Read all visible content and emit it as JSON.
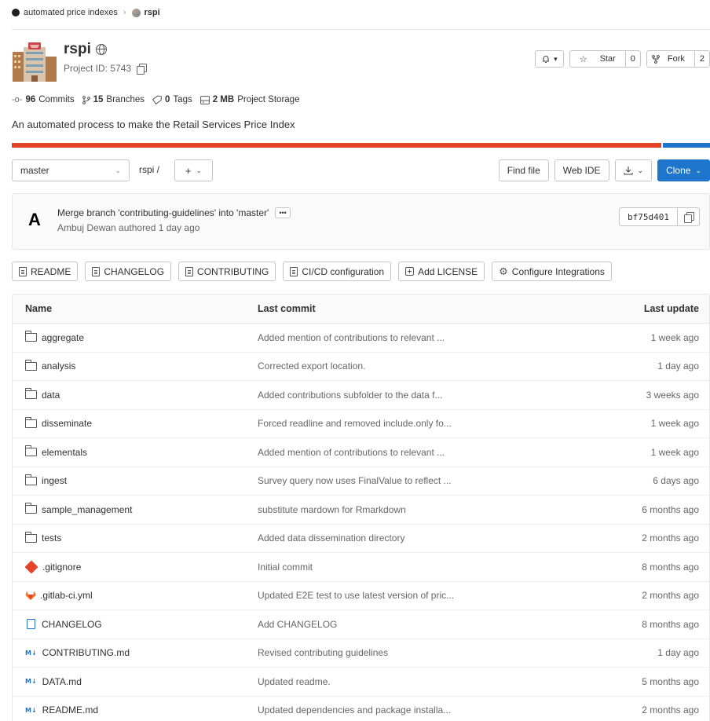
{
  "breadcrumb": {
    "group": "automated price indexes",
    "project": "rspi"
  },
  "project": {
    "name": "rspi",
    "id_text": "Project ID: 5743"
  },
  "actions": {
    "notify_chevron": "⌄",
    "star_label": "Star",
    "star_count": "0",
    "fork_label": "Fork",
    "fork_count": "2"
  },
  "stats": {
    "commits_num": "96",
    "commits_label": "Commits",
    "branches_num": "15",
    "branches_label": "Branches",
    "tags_num": "0",
    "tags_label": "Tags",
    "storage_num": "2 MB",
    "storage_label": "Project Storage"
  },
  "description": "An automated process to make the Retail Services Price Index",
  "colors": {
    "lang_primary": "#e24329",
    "lang_secondary": "#1f75cb",
    "primary_button": "#1f75cb"
  },
  "toolbar": {
    "branch": "master",
    "path": "rspi /",
    "find_file": "Find file",
    "web_ide": "Web IDE",
    "clone": "Clone"
  },
  "last_commit": {
    "avatar_letter": "A",
    "title": "Merge branch 'contributing-guidelines' into 'master'",
    "ellipsis": "•••",
    "author": "Ambuj Dewan authored 1 day ago",
    "sha": "bf75d401"
  },
  "quick_links": [
    "README",
    "CHANGELOG",
    "CONTRIBUTING",
    "CI/CD configuration",
    "Add LICENSE",
    "Configure Integrations"
  ],
  "table": {
    "headers": {
      "name": "Name",
      "commit": "Last commit",
      "date": "Last update"
    },
    "rows": [
      {
        "name": "aggregate",
        "commit": "Added mention of contributions to relevant ...",
        "date": "1 week ago"
      },
      {
        "name": "analysis",
        "commit": "Corrected export location.",
        "date": "1 day ago"
      },
      {
        "name": "data",
        "commit": "Added contributions subfolder to the data f...",
        "date": "3 weeks ago"
      },
      {
        "name": "disseminate",
        "commit": "Forced readline and removed include.only fo...",
        "date": "1 week ago"
      },
      {
        "name": "elementals",
        "commit": "Added mention of contributions to relevant ...",
        "date": "1 week ago"
      },
      {
        "name": "ingest",
        "commit": "Survey query now uses FinalValue to reflect ...",
        "date": "6 days ago"
      },
      {
        "name": "sample_management",
        "commit": "substitute mardown for Rmarkdown",
        "date": "6 months ago"
      },
      {
        "name": "tests",
        "commit": "Added data dissemination directory",
        "date": "2 months ago"
      },
      {
        "name": ".gitignore",
        "commit": "Initial commit",
        "date": "8 months ago"
      },
      {
        "name": ".gitlab-ci.yml",
        "commit": "Updated E2E test to use latest version of pric...",
        "date": "2 months ago"
      },
      {
        "name": "CHANGELOG",
        "commit": "Add CHANGELOG",
        "date": "8 months ago"
      },
      {
        "name": "CONTRIBUTING.md",
        "commit": "Revised contributing guidelines",
        "date": "1 day ago"
      },
      {
        "name": "DATA.md",
        "commit": "Updated readme.",
        "date": "5 months ago"
      },
      {
        "name": "README.md",
        "commit": "Updated dependencies and package installa...",
        "date": "2 months ago"
      }
    ]
  }
}
